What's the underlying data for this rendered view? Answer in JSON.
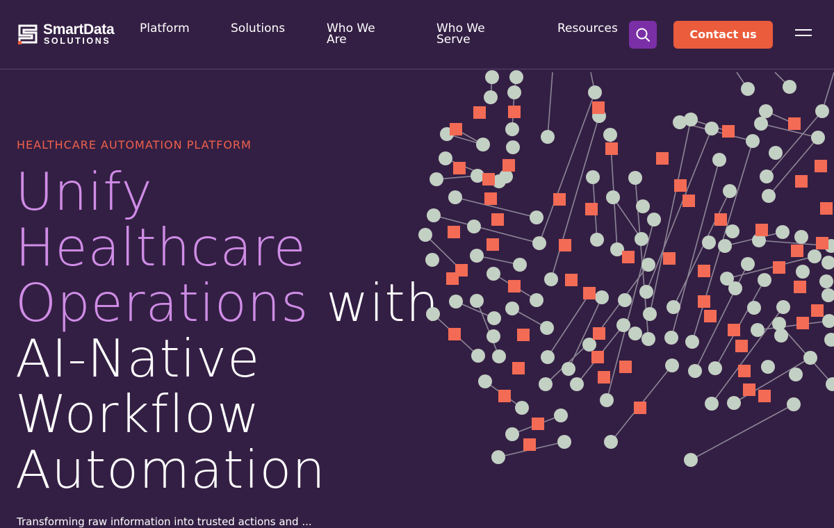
{
  "brand": {
    "name": "SmartData",
    "subtitle": "SOLUTIONS",
    "logo_icon": "sds-logo-icon"
  },
  "nav": {
    "items": [
      {
        "label": "Platform"
      },
      {
        "label": "Solutions"
      },
      {
        "label": "Who We Are"
      },
      {
        "label": "Who We Serve"
      },
      {
        "label": "Resources"
      }
    ],
    "search_icon": "search-icon",
    "contact_label": "Contact us",
    "menu_icon": "menu-icon"
  },
  "hero": {
    "eyebrow": "HEALTHCARE AUTOMATION PLATFORM",
    "headline": {
      "accent_line1": "Unify",
      "accent_line2": "Healthcare",
      "accent_line3": "Operations",
      "plain_tail": "with",
      "plain_line4": "AI-Native",
      "plain_line5": "Workflow",
      "plain_line6": "Automation"
    },
    "subtext": "Transforming raw information into trusted actions and ...",
    "illustration": "node-network-graphic"
  },
  "colors": {
    "background": "#341f44",
    "accent_orange": "#ea5c3c",
    "accent_purple": "#cf8de6",
    "search_purple": "#7b2fa6",
    "node_green": "#c3d0c4",
    "node_square": "#f36b55"
  }
}
